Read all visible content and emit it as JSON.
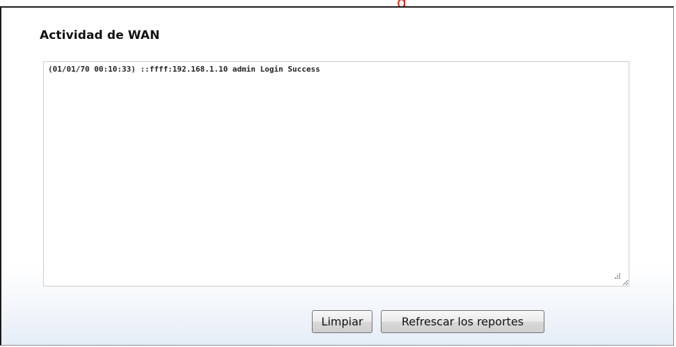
{
  "header": {
    "cropped_title_fragment": "g"
  },
  "section": {
    "title": "Actividad de WAN"
  },
  "log": {
    "content": "(01/01/70 00:10:33) ::ffff:192.168.1.10 admin Login Success"
  },
  "actions": {
    "clear_label": "Limpiar",
    "refresh_label": "Refrescar los reportes"
  },
  "colors": {
    "accent_red": "#e0291b",
    "frame_border": "#1a1a1a",
    "panel_gradient_bottom": "#e3ecf6"
  }
}
